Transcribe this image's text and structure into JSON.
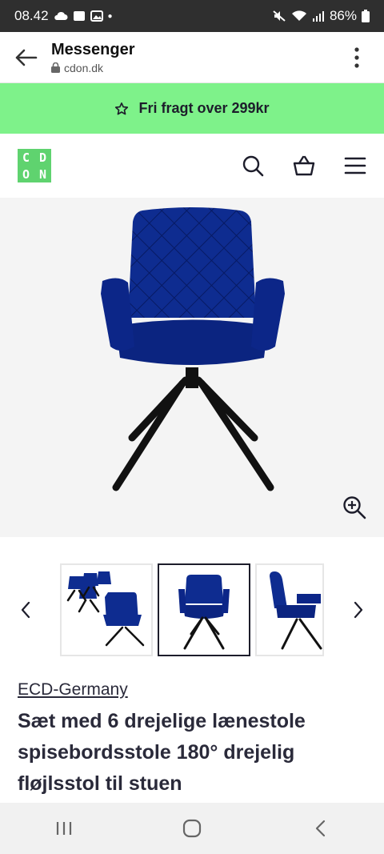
{
  "status_bar": {
    "time": "08.42",
    "battery": "86%"
  },
  "browser": {
    "title": "Messenger",
    "url": "cdon.dk"
  },
  "promo": {
    "text": "Fri fragt over 299kr"
  },
  "logo": {
    "letters": [
      "C",
      "D",
      "O",
      "N"
    ]
  },
  "product": {
    "brand": "ECD-Germany",
    "title": "Sæt med 6 drejelige lænestole spisebordsstole 180° drejelig fløjlsstol til stuen"
  },
  "colors": {
    "accent_green": "#7ef28a",
    "logo_green": "#5fd36f",
    "chair_blue": "#0d2a8c",
    "text_dark": "#2a2a3a"
  },
  "icons": [
    "back-arrow-icon",
    "lock-icon",
    "kebab-menu-icon",
    "star-icon",
    "search-icon",
    "basket-icon",
    "hamburger-menu-icon",
    "zoom-in-icon",
    "chevron-left-icon",
    "chevron-right-icon"
  ]
}
